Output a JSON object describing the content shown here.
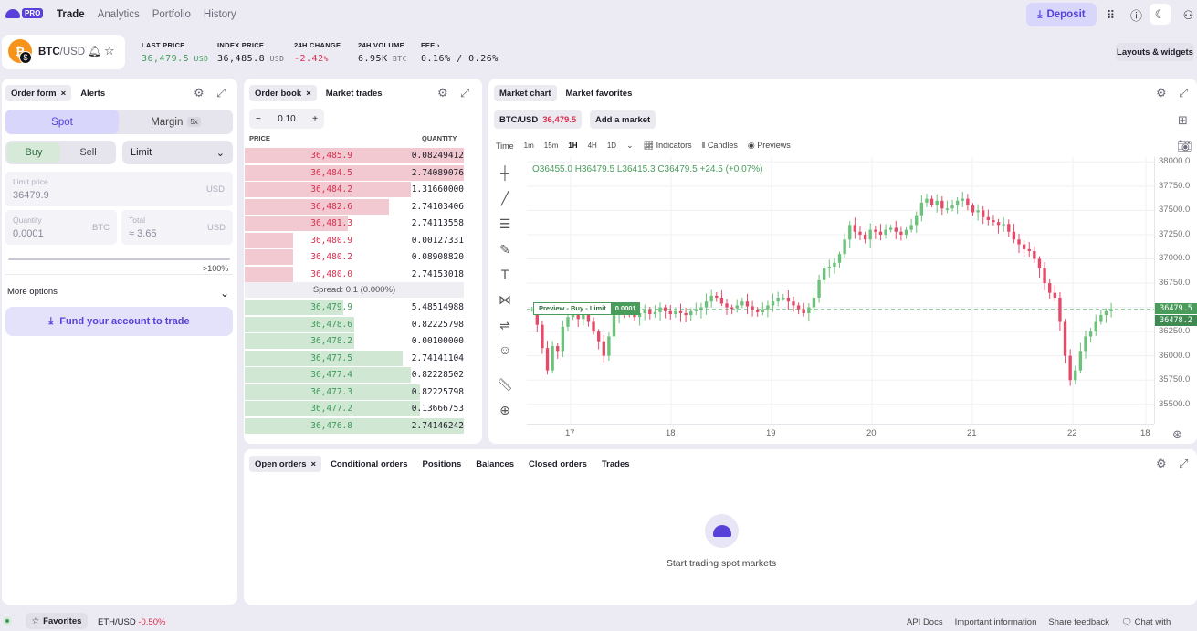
{
  "nav": {
    "brand": "PRO",
    "links": [
      "Trade",
      "Analytics",
      "Portfolio",
      "History"
    ],
    "deposit": "Deposit"
  },
  "ticker": {
    "base": "BTC",
    "quote": "/USD",
    "stats": [
      {
        "label": "LAST PRICE",
        "value": "36,479.5",
        "unit": "USD"
      },
      {
        "label": "INDEX PRICE",
        "value": "36,485.8",
        "unit": "USD"
      },
      {
        "label": "24H CHANGE",
        "value": "-2.42",
        "unit": "%"
      },
      {
        "label": "24H VOLUME",
        "value": "6.95K",
        "unit": "BTC"
      },
      {
        "label": "FEE",
        "value": "0.16% / 0.26%",
        "unit": ""
      }
    ],
    "layouts": "Layouts & widgets"
  },
  "order_form": {
    "tabs": [
      "Order form",
      "Alerts"
    ],
    "spot": "Spot",
    "margin": "Margin",
    "margin_badge": "5x",
    "buy": "Buy",
    "sell": "Sell",
    "order_type": "Limit",
    "limit_label": "Limit price",
    "limit_value": "36479.9",
    "limit_unit": "USD",
    "qty_label": "Quantity",
    "qty_value": "0.0001",
    "qty_unit": "BTC",
    "total_label": "Total",
    "total_value": "≈ 3.65",
    "total_unit": "USD",
    "slider_max": ">100%",
    "more": "More options",
    "fund": "Fund your account to trade"
  },
  "orderbook": {
    "tabs": [
      "Order book",
      "Market trades"
    ],
    "step": "0.10",
    "minus": "−",
    "plus": "+",
    "col_price": "PRICE",
    "col_qty": "QUANTITY",
    "asks": [
      {
        "price": "36,485.9",
        "qty": "0.08249412",
        "depth": 1.0
      },
      {
        "price": "36,484.5",
        "qty": "2.74089076",
        "depth": 1.0
      },
      {
        "price": "36,484.2",
        "qty": "1.31660000",
        "depth": 0.76
      },
      {
        "price": "36,482.6",
        "qty": "2.74103406",
        "depth": 0.66
      },
      {
        "price": "36,481.3",
        "qty": "2.74113558",
        "depth": 0.47
      },
      {
        "price": "36,480.9",
        "qty": "0.00127331",
        "depth": 0.22
      },
      {
        "price": "36,480.2",
        "qty": "0.08908820",
        "depth": 0.22
      },
      {
        "price": "36,480.0",
        "qty": "2.74153018",
        "depth": 0.22
      }
    ],
    "spread": "Spread: 0.1 (0.000%)",
    "bids": [
      {
        "price": "36,479.9",
        "qty": "5.48514988",
        "depth": 0.45
      },
      {
        "price": "36,478.6",
        "qty": "0.82225798",
        "depth": 0.5
      },
      {
        "price": "36,478.2",
        "qty": "0.00100000",
        "depth": 0.5
      },
      {
        "price": "36,477.5",
        "qty": "2.74141104",
        "depth": 0.72
      },
      {
        "price": "36,477.4",
        "qty": "0.82228502",
        "depth": 0.76
      },
      {
        "price": "36,477.3",
        "qty": "0.82225798",
        "depth": 0.8
      },
      {
        "price": "36,477.2",
        "qty": "0.13666753",
        "depth": 0.8
      },
      {
        "price": "36,476.8",
        "qty": "2.74146242",
        "depth": 1.0
      }
    ]
  },
  "chart": {
    "tabs": [
      "Market chart",
      "Market favorites"
    ],
    "pair": "BTC/USD",
    "pair_price": "36,479.5",
    "add": "Add a market",
    "time_label": "Time",
    "intervals": [
      "1m",
      "15m",
      "1H",
      "4H",
      "1D"
    ],
    "active_interval": "1H",
    "indicators": "Indicators",
    "candles": "Candles",
    "previews": "Previews",
    "ohlc": "O36455.0  H36479.5  L36415.3  C36479.5  +24.5 (+0.07%)",
    "preview_label": "Preview - Buy - Limit",
    "preview_qty": "0.0001",
    "price_tag1": "36479.5",
    "price_tag2": "36478.2",
    "up_color": "#6cc17b",
    "down_color": "#e34b6a"
  },
  "chart_data": {
    "type": "candlestick",
    "x_ticks": [
      "17",
      "18",
      "19",
      "20",
      "21",
      "22",
      "18"
    ],
    "y_ticks": [
      38000,
      37750,
      37500,
      37250,
      37000,
      36750,
      36500,
      36250,
      36000,
      35750,
      35500
    ],
    "ylim": [
      35300,
      38050
    ],
    "last_price": 36479.5,
    "closes": [
      36480,
      36320,
      36080,
      35850,
      36100,
      36050,
      36300,
      36400,
      36420,
      36380,
      36450,
      36350,
      36250,
      36150,
      36000,
      36200,
      36420,
      36480,
      36460,
      36450,
      36400,
      36440,
      36470,
      36430,
      36450,
      36500,
      36460,
      36430,
      36460,
      36440,
      36420,
      36460,
      36480,
      36500,
      36560,
      36620,
      36600,
      36540,
      36500,
      36490,
      36520,
      36560,
      36510,
      36470,
      36450,
      36480,
      36520,
      36560,
      36600,
      36600,
      36560,
      36520,
      36480,
      36440,
      36500,
      36600,
      36780,
      36900,
      36920,
      36960,
      37050,
      37200,
      37350,
      37280,
      37250,
      37200,
      37300,
      37280,
      37250,
      37300,
      37320,
      37280,
      37250,
      37300,
      37350,
      37450,
      37580,
      37620,
      37560,
      37600,
      37520,
      37520,
      37550,
      37600,
      37620,
      37550,
      37480,
      37500,
      37430,
      37400,
      37380,
      37350,
      37360,
      37280,
      37200,
      37150,
      37100,
      37080,
      37000,
      36900,
      36750,
      36650,
      36600,
      36350,
      36000,
      35750,
      35850,
      36050,
      36200,
      36250,
      36350,
      36420,
      36460,
      36480
    ]
  },
  "bottom": {
    "tabs": [
      "Open orders",
      "Conditional orders",
      "Positions",
      "Balances",
      "Closed orders",
      "Trades"
    ],
    "empty": "Start trading spot markets"
  },
  "footer": {
    "favorites": "Favorites",
    "pair": "ETH/USD",
    "change": "-0.50%",
    "links": [
      "API Docs",
      "Important information",
      "Share feedback",
      "Chat with"
    ]
  }
}
